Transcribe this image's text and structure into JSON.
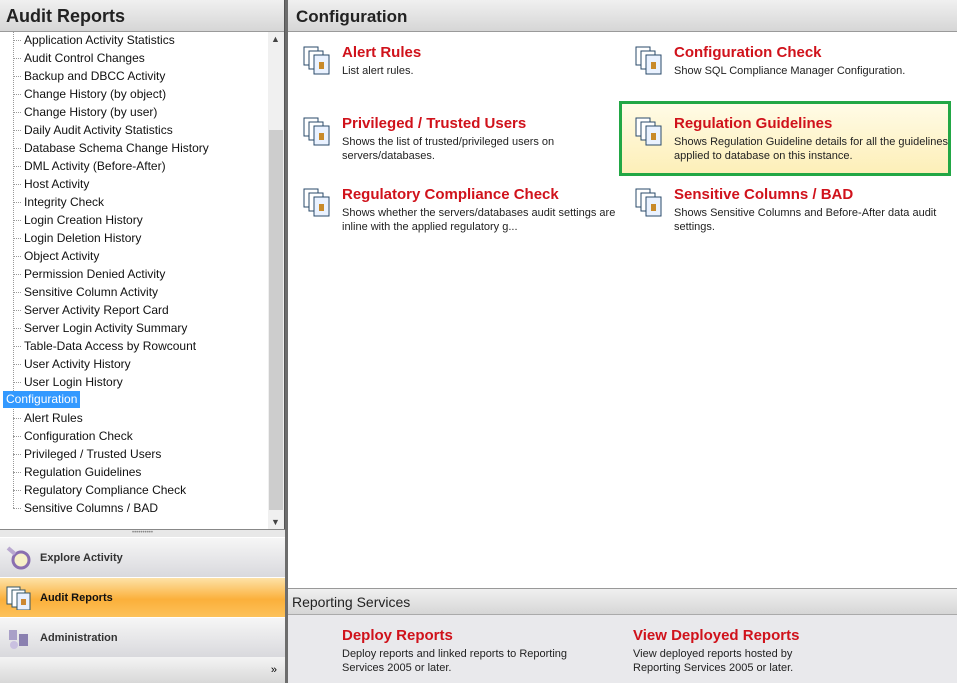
{
  "left": {
    "title": "Audit Reports",
    "tree_items": [
      "Application Activity Statistics",
      "Audit Control Changes",
      "Backup and DBCC Activity",
      "Change History (by object)",
      "Change History (by user)",
      "Daily Audit Activity Statistics",
      "Database Schema Change History",
      "DML Activity (Before-After)",
      "Host Activity",
      "Integrity Check",
      "Login Creation History",
      "Login Deletion History",
      "Object Activity",
      "Permission Denied Activity",
      "Sensitive Column Activity",
      "Server Activity Report Card",
      "Server Login Activity Summary",
      "Table-Data Access by Rowcount",
      "User Activity History",
      "User Login History"
    ],
    "config_node": "Configuration",
    "config_items": [
      "Alert Rules",
      "Configuration Check",
      "Privileged / Trusted Users",
      "Regulation Guidelines",
      "Regulatory Compliance Check",
      "Sensitive Columns / BAD"
    ],
    "nav": [
      {
        "label": "Explore Activity"
      },
      {
        "label": "Audit Reports"
      },
      {
        "label": "Administration"
      }
    ]
  },
  "main": {
    "title": "Configuration",
    "items": [
      {
        "title": "Alert Rules",
        "desc": "List alert rules."
      },
      {
        "title": "Configuration Check",
        "desc": "Show SQL Compliance Manager Configuration."
      },
      {
        "title": "Privileged / Trusted Users",
        "desc": "Shows the list of trusted/privileged users on servers/databases."
      },
      {
        "title": "Regulation Guidelines",
        "desc": "Shows Regulation Guideline details for all the guidelines applied to database on this instance."
      },
      {
        "title": "Regulatory Compliance Check",
        "desc": "Shows whether the servers/databases audit settings are inline with the applied regulatory g..."
      },
      {
        "title": "Sensitive Columns / BAD",
        "desc": "Shows Sensitive Columns and Before-After data audit settings."
      }
    ],
    "rs_title": "Reporting Services",
    "rs_items": [
      {
        "title": "Deploy Reports",
        "desc": "Deploy reports and linked reports to Reporting Services 2005 or later."
      },
      {
        "title": "View Deployed Reports",
        "desc": "View deployed reports hosted by Reporting Services 2005 or later."
      }
    ]
  }
}
